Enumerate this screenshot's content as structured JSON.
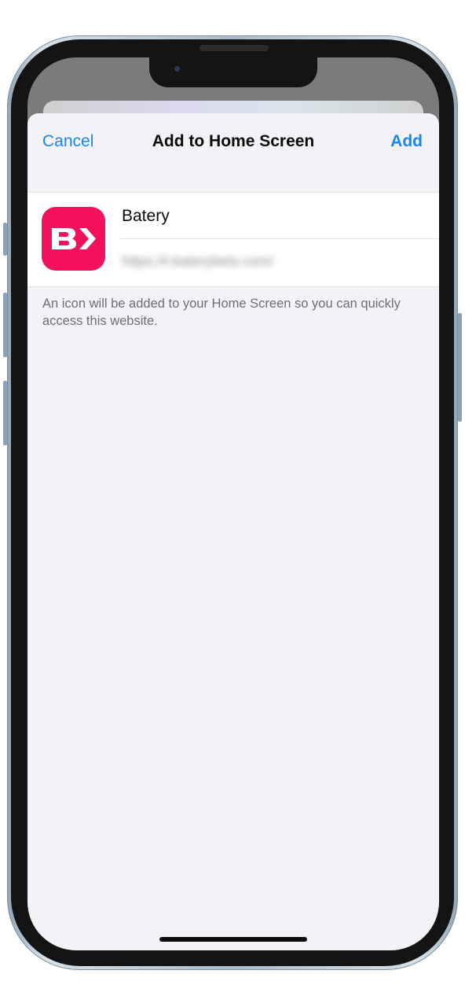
{
  "sheet": {
    "cancel_label": "Cancel",
    "title": "Add to Home Screen",
    "add_label": "Add"
  },
  "app": {
    "name": "Batery",
    "url": "https://t-baterybets.com/",
    "icon_color": "#f2115a",
    "icon": "batery-logo-icon"
  },
  "note": "An icon will be added to your Home Screen so you can quickly access this website.",
  "colors": {
    "accent": "#1e86e8",
    "background": "#f2f2f7",
    "secondary_text": "#6e6e73"
  }
}
